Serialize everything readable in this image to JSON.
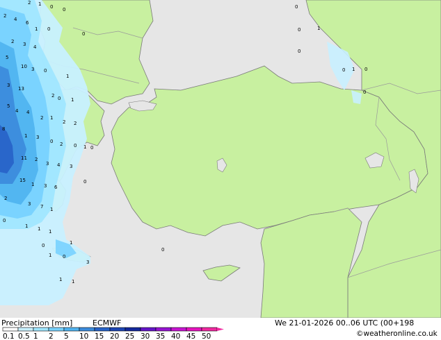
{
  "map": {
    "colors": {
      "sea": "#e6e6e6",
      "land": "#c8f0a0",
      "border": "#9a9a9a",
      "coast": "#7a7a7a"
    },
    "precip_labels": [
      {
        "text": "2"
      },
      {
        "text": "1"
      },
      {
        "text": "0"
      },
      {
        "text": "0"
      },
      {
        "text": "2"
      },
      {
        "text": "4"
      },
      {
        "text": "6"
      },
      {
        "text": "1"
      },
      {
        "text": "0"
      },
      {
        "text": "0"
      },
      {
        "text": "2"
      },
      {
        "text": "3"
      },
      {
        "text": "4"
      },
      {
        "text": "5"
      },
      {
        "text": "10"
      },
      {
        "text": "3"
      },
      {
        "text": "0"
      },
      {
        "text": "1"
      },
      {
        "text": "3"
      },
      {
        "text": "13"
      },
      {
        "text": "2"
      },
      {
        "text": "0"
      },
      {
        "text": "1"
      },
      {
        "text": "5"
      },
      {
        "text": "4"
      },
      {
        "text": "4"
      },
      {
        "text": "2"
      },
      {
        "text": "1"
      },
      {
        "text": "2"
      },
      {
        "text": "2"
      },
      {
        "text": "8"
      },
      {
        "text": "1"
      },
      {
        "text": "3"
      },
      {
        "text": "0"
      },
      {
        "text": "2"
      },
      {
        "text": "0"
      },
      {
        "text": "1"
      },
      {
        "text": "11"
      },
      {
        "text": "2"
      },
      {
        "text": "3"
      },
      {
        "text": "4"
      },
      {
        "text": "3"
      },
      {
        "text": "15"
      },
      {
        "text": "1"
      },
      {
        "text": "3"
      },
      {
        "text": "6"
      },
      {
        "text": "2"
      },
      {
        "text": "3"
      },
      {
        "text": "7"
      },
      {
        "text": "1"
      },
      {
        "text": "0"
      },
      {
        "text": "1"
      },
      {
        "text": "1"
      },
      {
        "text": "1"
      },
      {
        "text": "0"
      },
      {
        "text": "1"
      },
      {
        "text": "0"
      },
      {
        "text": "1"
      },
      {
        "text": "0"
      },
      {
        "text": "3"
      },
      {
        "text": "1"
      },
      {
        "text": "1"
      },
      {
        "text": "0"
      },
      {
        "text": "0"
      },
      {
        "text": "1"
      },
      {
        "text": "0"
      },
      {
        "text": "0"
      },
      {
        "text": "1"
      },
      {
        "text": "0"
      },
      {
        "text": "0"
      },
      {
        "text": "0"
      },
      {
        "text": "0"
      }
    ]
  },
  "footer": {
    "title": "Precipitation [mm]",
    "model": "ECMWF",
    "datetime": "We 21-01-2026 00..06 UTC (00+198",
    "credit": "©weatheronline.co.uk",
    "legend": [
      {
        "label": "0.1",
        "color": "#ffffff"
      },
      {
        "label": "0.5",
        "color": "#c8f0ff"
      },
      {
        "label": "1",
        "color": "#a0e6ff"
      },
      {
        "label": "2",
        "color": "#78d2ff"
      },
      {
        "label": "5",
        "color": "#50b4f0"
      },
      {
        "label": "10",
        "color": "#3c8cdc"
      },
      {
        "label": "15",
        "color": "#2864c8"
      },
      {
        "label": "20",
        "color": "#1e46b4"
      },
      {
        "label": "25",
        "color": "#14289c"
      },
      {
        "label": "30",
        "color": "#6414c8"
      },
      {
        "label": "35",
        "color": "#9614d2"
      },
      {
        "label": "40",
        "color": "#c814d2"
      },
      {
        "label": "45",
        "color": "#e614be"
      },
      {
        "label": "50",
        "color": "#f028a0"
      }
    ]
  }
}
